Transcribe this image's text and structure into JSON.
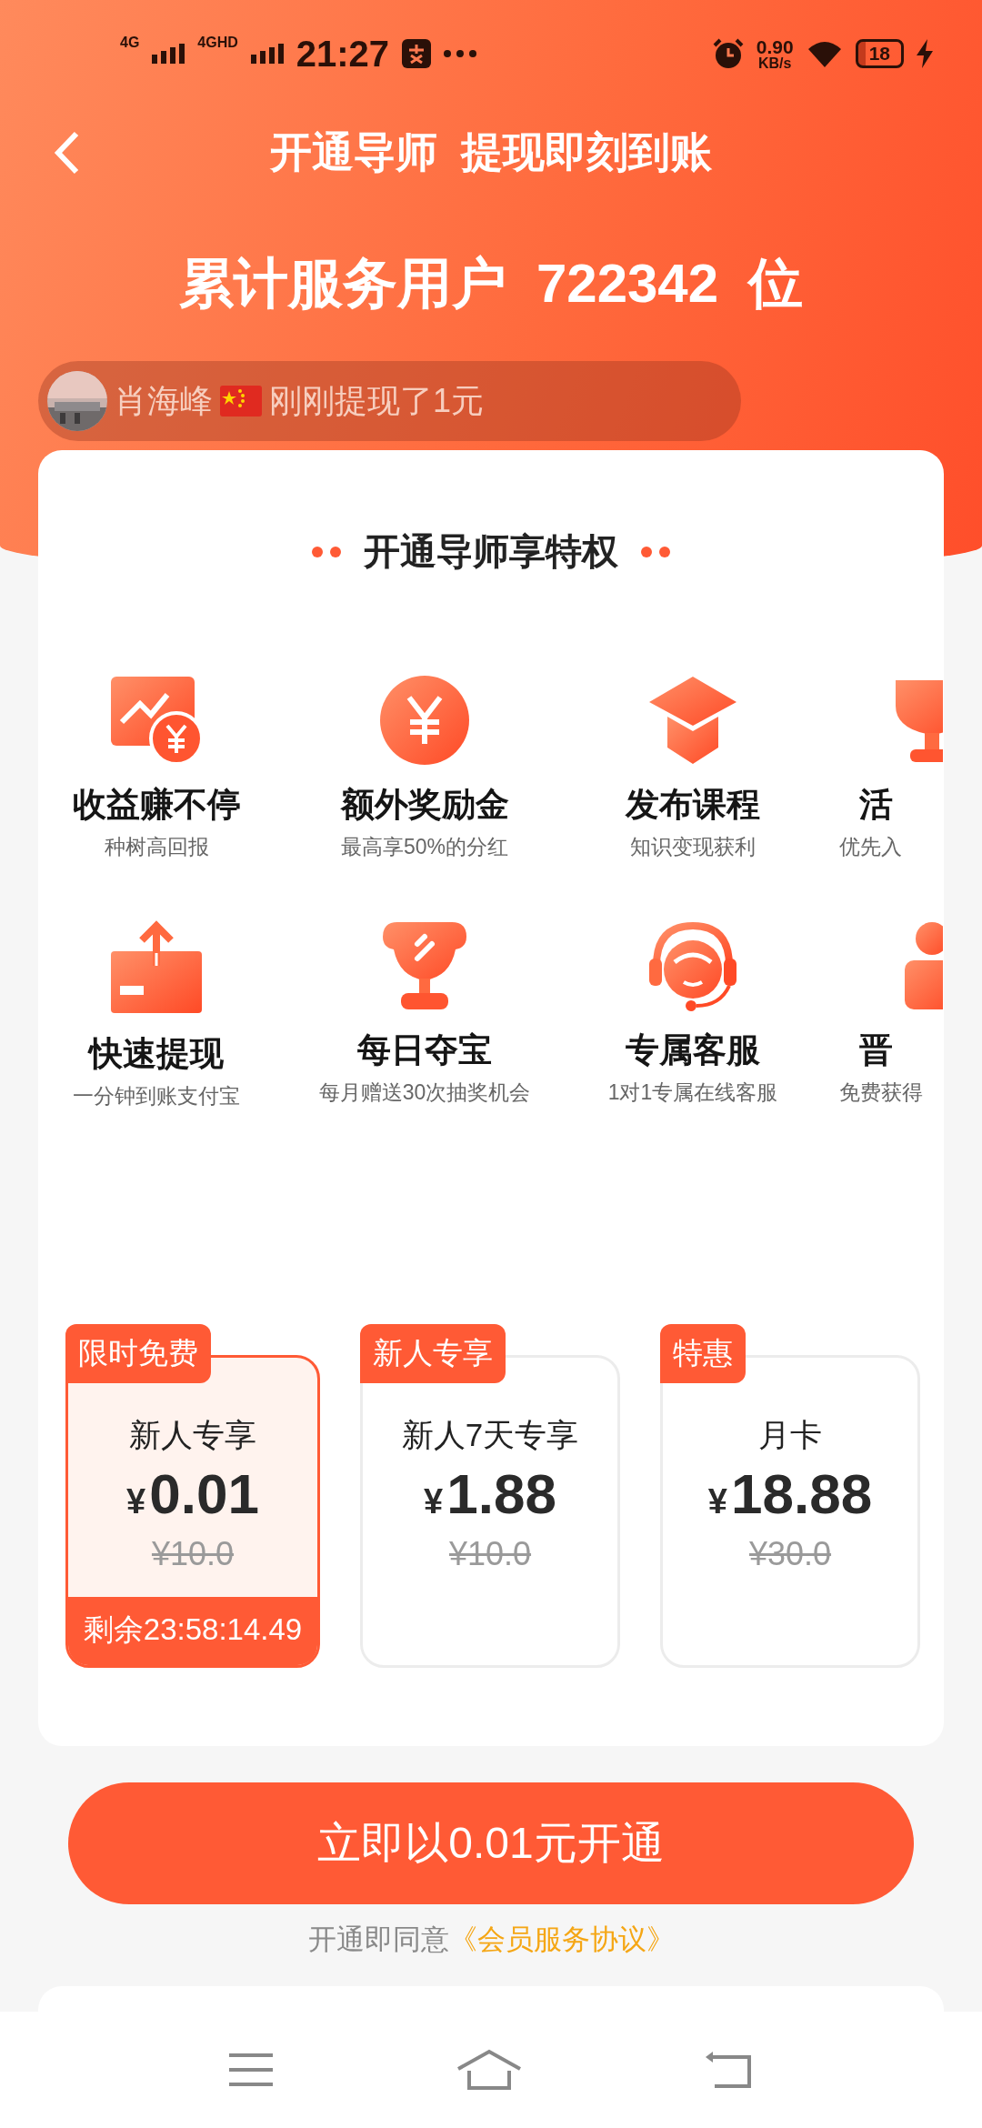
{
  "status_bar": {
    "network_1": "4G",
    "network_2": "4GHD",
    "time": "21:27",
    "speed": "0.90",
    "speed_unit": "KB/s",
    "battery": "18"
  },
  "header": {
    "title": "开通导师  提现即刻到账"
  },
  "counter": {
    "text": "累计服务用户  722342  位"
  },
  "ticker": {
    "name": "肖海峰",
    "message": "刚刚提现了1元"
  },
  "privileges": {
    "title": "开通导师享特权",
    "items": [
      {
        "title": "收益赚不停",
        "subtitle": "种树高回报"
      },
      {
        "title": "额外奖励金",
        "subtitle": "最高享50%的分红"
      },
      {
        "title": "发布课程",
        "subtitle": "知识变现获利"
      },
      {
        "title": "活",
        "subtitle": "优先入"
      },
      {
        "title": "快速提现",
        "subtitle": "一分钟到账支付宝"
      },
      {
        "title": "每日夺宝",
        "subtitle": "每月赠送30次抽奖机会"
      },
      {
        "title": "专属客服",
        "subtitle": "1对1专属在线客服"
      },
      {
        "title": "晋",
        "subtitle": "免费获得"
      }
    ]
  },
  "plans": [
    {
      "tag": "限时免费",
      "name": "新人专享",
      "currency": "¥",
      "price": "0.01",
      "original": "¥10.0",
      "selected": true,
      "countdown": "剩余23:58:14.49"
    },
    {
      "tag": "新人专享",
      "name": "新人7天专享",
      "currency": "¥",
      "price": "1.88",
      "original": "¥10.0",
      "selected": false
    },
    {
      "tag": "特惠",
      "name": "月卡",
      "currency": "¥",
      "price": "18.88",
      "original": "¥30.0",
      "selected": false
    }
  ],
  "action": {
    "button": "立即以0.01元开通",
    "agreement_prefix": "开通即同意",
    "agreement_link": "《会员服务协议》"
  }
}
